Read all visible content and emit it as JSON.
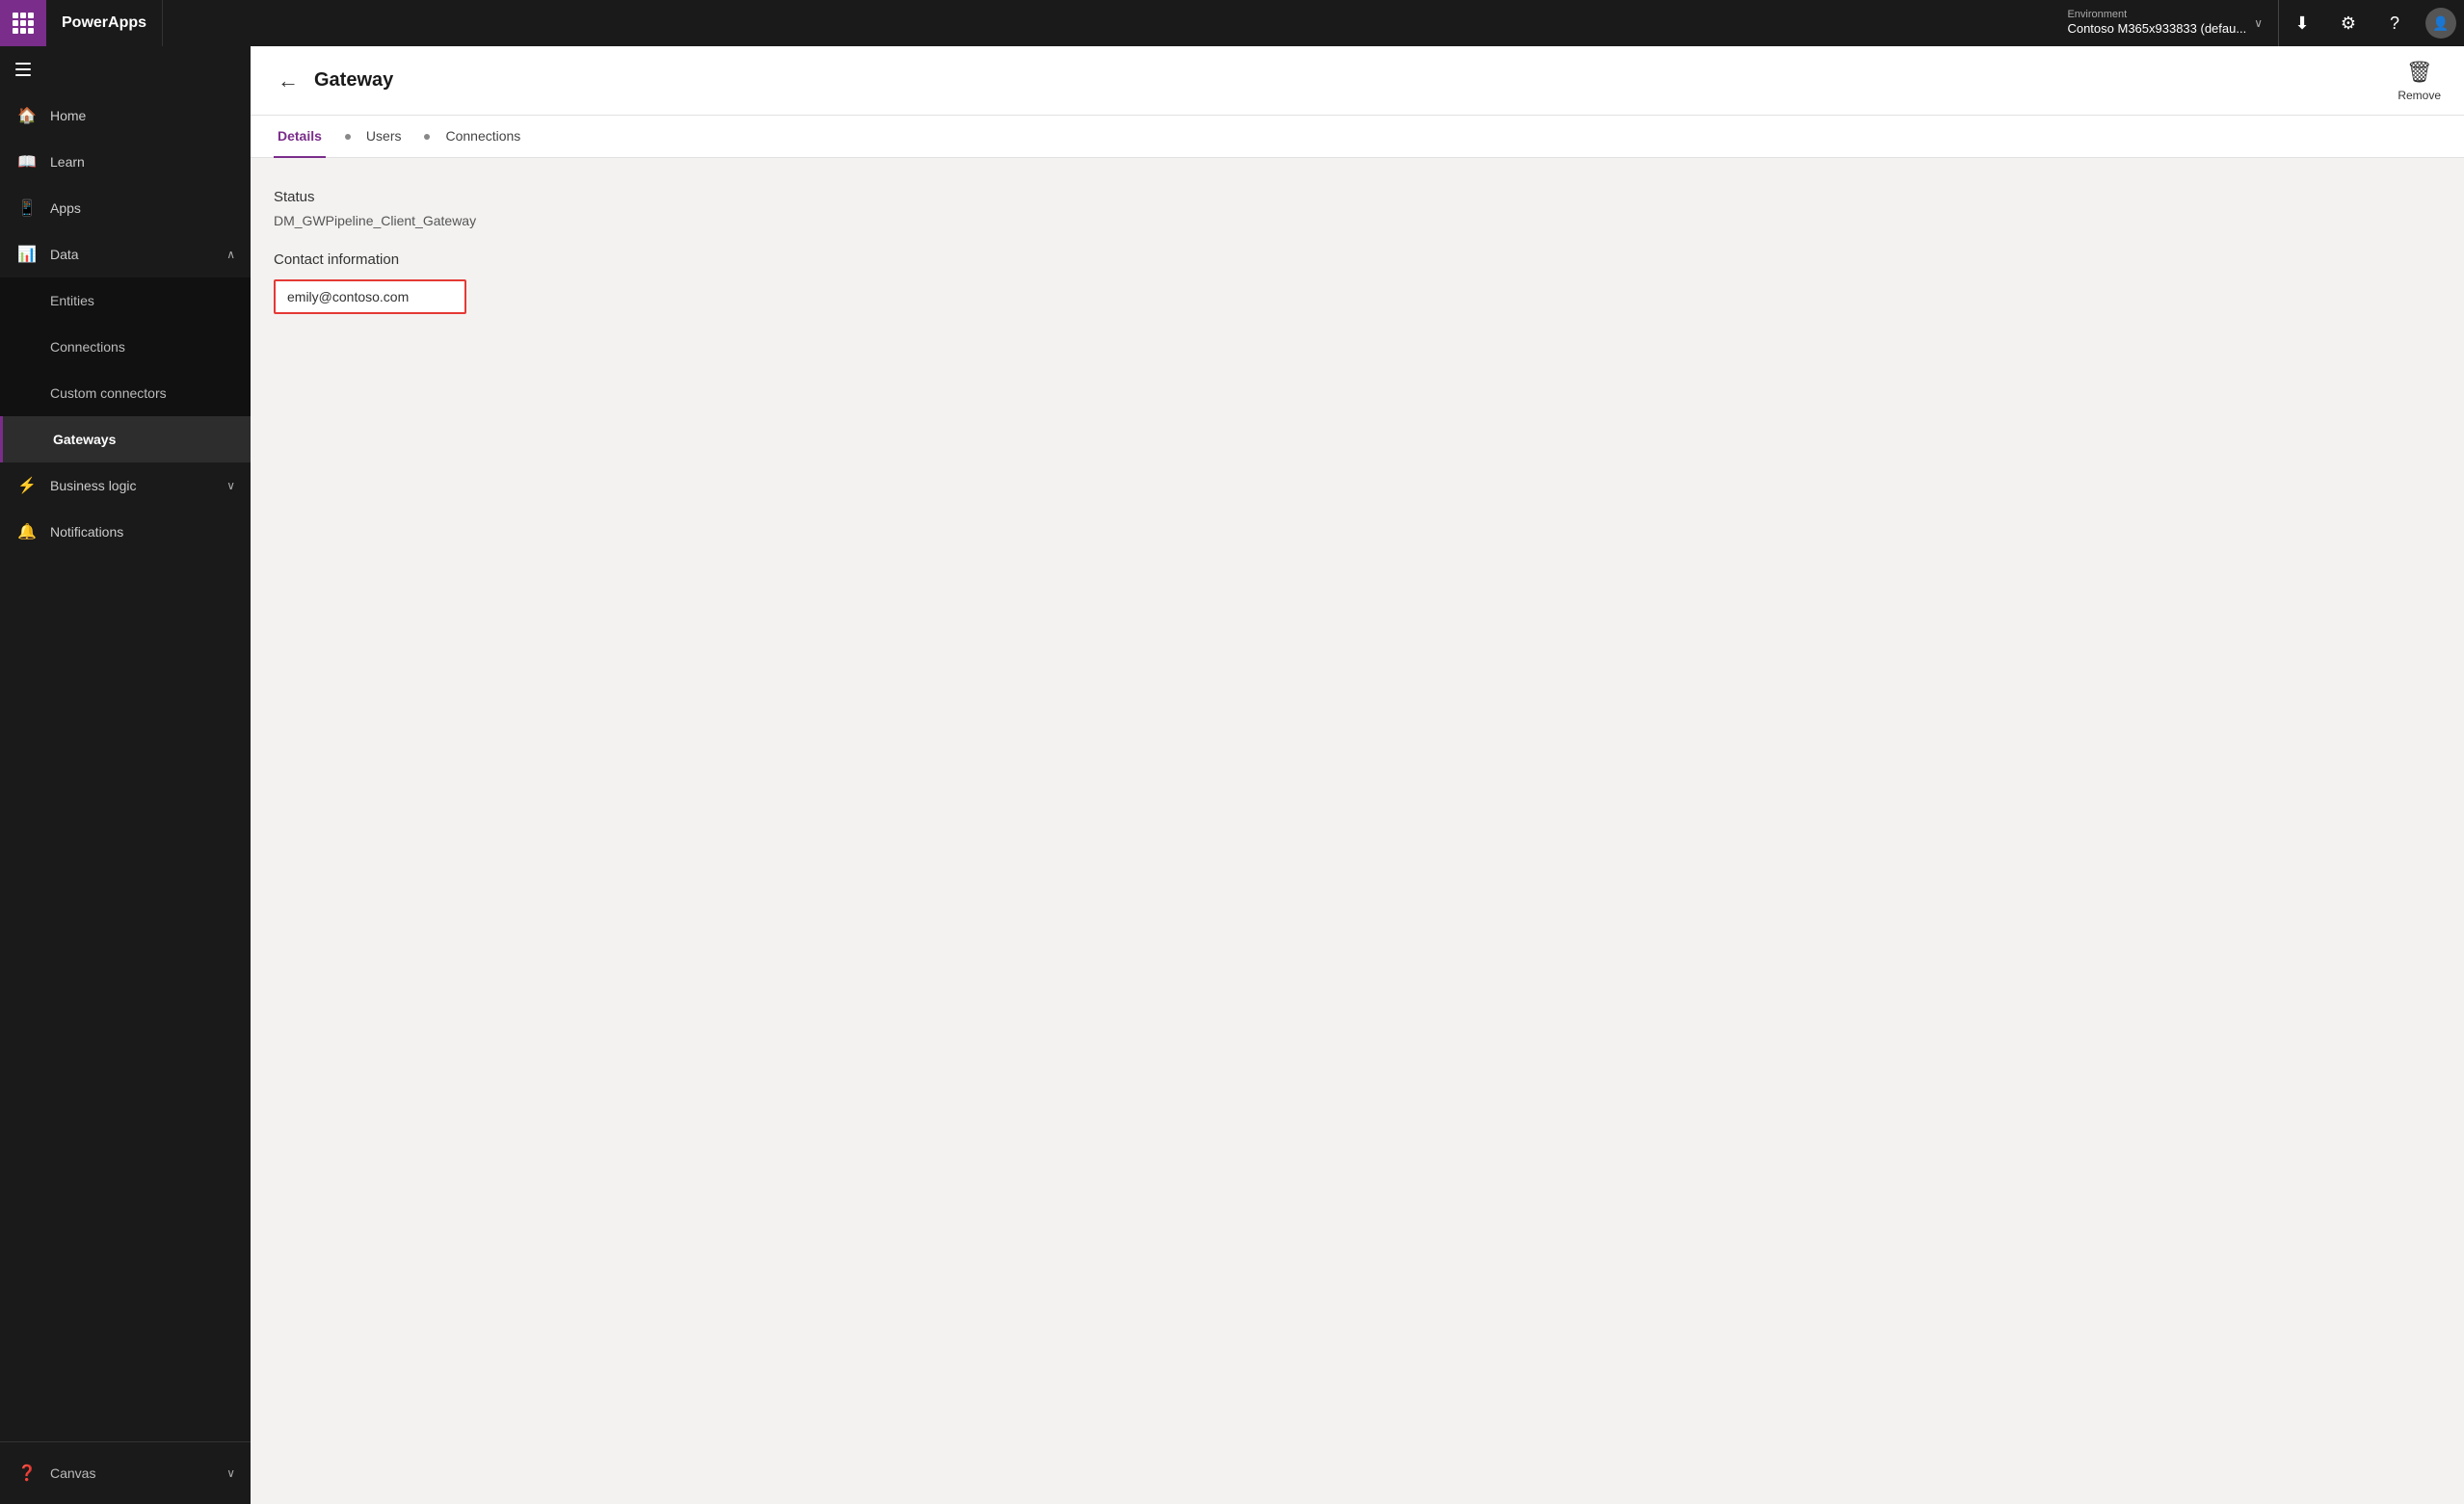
{
  "topbar": {
    "brand": "PowerApps",
    "environment_label": "Environment",
    "environment_name": "Contoso M365x933833 (defau...",
    "download_icon": "⬇",
    "settings_icon": "⚙",
    "help_icon": "?",
    "avatar_letter": ""
  },
  "sidebar": {
    "hamburger_label": "Menu",
    "items": [
      {
        "id": "home",
        "label": "Home",
        "icon": "🏠",
        "active": false
      },
      {
        "id": "learn",
        "label": "Learn",
        "icon": "📖",
        "active": false
      },
      {
        "id": "apps",
        "label": "Apps",
        "icon": "📱",
        "active": false
      },
      {
        "id": "data",
        "label": "Data",
        "icon": "📊",
        "active": false,
        "expanded": true,
        "chevron": "∧"
      }
    ],
    "subitems": [
      {
        "id": "entities",
        "label": "Entities",
        "active": false
      },
      {
        "id": "connections",
        "label": "Connections",
        "active": false
      },
      {
        "id": "custom-connectors",
        "label": "Custom connectors",
        "active": false
      },
      {
        "id": "gateways",
        "label": "Gateways",
        "active": true
      }
    ],
    "bottom_items": [
      {
        "id": "business-logic",
        "label": "Business logic",
        "icon": "⚡",
        "active": false,
        "chevron": "∨"
      },
      {
        "id": "notifications",
        "label": "Notifications",
        "icon": "🔔",
        "active": false
      }
    ],
    "footer": [
      {
        "id": "canvas",
        "label": "Canvas",
        "icon": "❓",
        "chevron": "∨"
      }
    ]
  },
  "page": {
    "back_label": "←",
    "title": "Gateway",
    "remove_label": "Remove",
    "tabs": [
      {
        "id": "details",
        "label": "Details",
        "active": true
      },
      {
        "id": "users",
        "label": "Users",
        "active": false
      },
      {
        "id": "connections",
        "label": "Connections",
        "active": false
      }
    ],
    "status_label": "Status",
    "gateway_name": "DM_GWPipeline_Client_Gateway",
    "contact_section_label": "Contact information",
    "contact_email": "emily@contoso.com"
  },
  "colors": {
    "accent": "#7B2D8B",
    "topbar_bg": "#1a1a1a",
    "sidebar_bg": "#1a1a1a",
    "highlight": "#e53935"
  }
}
